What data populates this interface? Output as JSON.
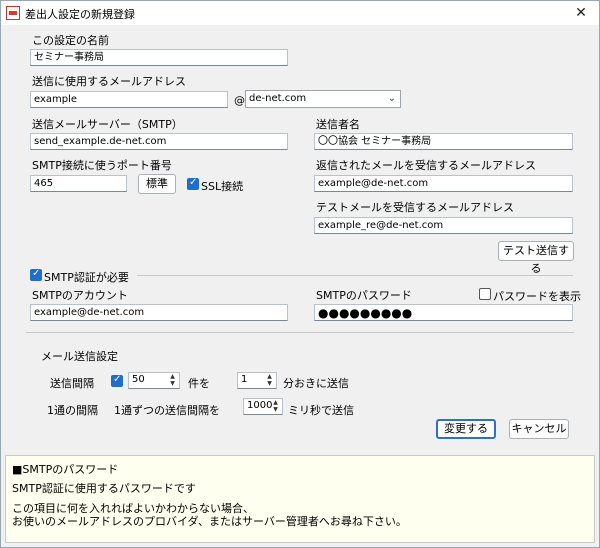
{
  "window": {
    "title": "差出人設定の新規登録",
    "close": "✕"
  },
  "name": {
    "label": "この設定の名前",
    "value": "セミナー事務局"
  },
  "address": {
    "label": "送信に使用するメールアドレス",
    "user": "example",
    "at": "@",
    "domain": "de-net.com"
  },
  "smtp_server": {
    "label": "送信メールサーバー（SMTP）",
    "value": "send_example.de-net.com"
  },
  "sender_name": {
    "label": "送信者名",
    "value": "〇〇協会  セミナー事務局"
  },
  "port": {
    "label": "SMTP接続に使うポート番号",
    "value": "465",
    "standard_button": "標準",
    "ssl_label": "SSL接続",
    "ssl_checked": true
  },
  "reply_to": {
    "label": "返信されたメールを受信するメールアドレス",
    "value": "example@de-net.com"
  },
  "test_mail": {
    "label": "テストメールを受信するメールアドレス",
    "value": "example_re@de-net.com",
    "button": "テスト送信する"
  },
  "auth": {
    "label": "SMTP認証が必要",
    "checked": true
  },
  "account": {
    "label": "SMTPのアカウント",
    "value": "example@de-net.com"
  },
  "password": {
    "label": "SMTPのパスワード",
    "value": "●●●●●●●●●",
    "show_label": "パスワードを表示",
    "show_checked": false
  },
  "send_settings": {
    "title": "メール送信設定",
    "interval_label": "送信間隔",
    "interval_checked": true,
    "count_value": "50",
    "count_suffix": "件を",
    "minutes_value": "1",
    "minutes_suffix": "分おきに送信",
    "per_mail_label": "1通の間隔",
    "per_mail_prefix": "1通ずつの送信間隔を",
    "ms_value": "1000",
    "ms_suffix": "ミリ秒で送信"
  },
  "buttons": {
    "apply": "変更する",
    "cancel": "キャンセル"
  },
  "help": {
    "title": "■SMTPのパスワード",
    "line1": "SMTP認証に使用するパスワードです",
    "line2": "この項目に何を入れればよいかわからない場合、",
    "line3": "お使いのメールアドレスのプロバイダ、またはサーバー管理者へお尋ね下さい。"
  }
}
